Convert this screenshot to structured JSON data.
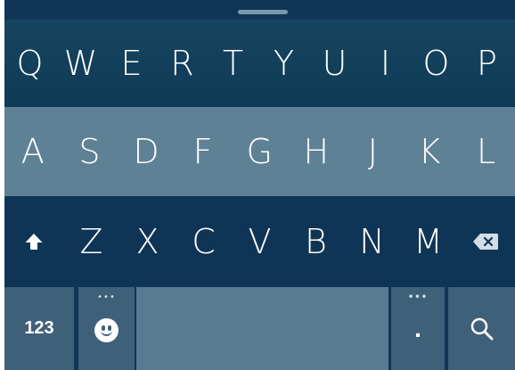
{
  "keyboard": {
    "row1": [
      "Q",
      "W",
      "E",
      "R",
      "T",
      "Y",
      "U",
      "I",
      "O",
      "P"
    ],
    "row2": [
      "A",
      "S",
      "D",
      "F",
      "G",
      "H",
      "J",
      "K",
      "L"
    ],
    "row3": [
      "Z",
      "X",
      "C",
      "V",
      "B",
      "N",
      "M"
    ],
    "bottom": {
      "numbers_label": "123",
      "period_label": ".",
      "more_indicator": "•••"
    },
    "icons": {
      "shift": "shift-arrow-icon",
      "backspace": "backspace-icon",
      "emoji": "smiley-icon",
      "search": "search-icon"
    },
    "colors": {
      "dark_row": "#0f3657",
      "light_row": "#5f8196",
      "function_key": "#3f6079",
      "space_key": "#5a7a92"
    }
  }
}
